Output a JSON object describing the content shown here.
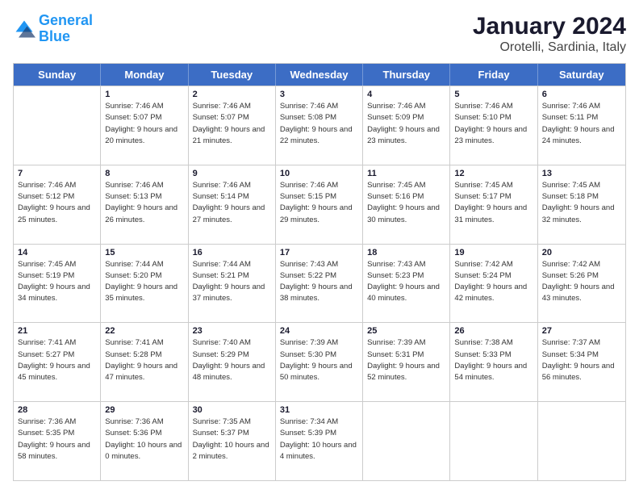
{
  "logo": {
    "line1": "General",
    "line2": "Blue"
  },
  "header": {
    "month": "January 2024",
    "location": "Orotelli, Sardinia, Italy"
  },
  "weekdays": [
    "Sunday",
    "Monday",
    "Tuesday",
    "Wednesday",
    "Thursday",
    "Friday",
    "Saturday"
  ],
  "rows": [
    [
      {
        "day": "",
        "sunrise": "",
        "sunset": "",
        "daylight": ""
      },
      {
        "day": "1",
        "sunrise": "Sunrise: 7:46 AM",
        "sunset": "Sunset: 5:07 PM",
        "daylight": "Daylight: 9 hours and 20 minutes."
      },
      {
        "day": "2",
        "sunrise": "Sunrise: 7:46 AM",
        "sunset": "Sunset: 5:07 PM",
        "daylight": "Daylight: 9 hours and 21 minutes."
      },
      {
        "day": "3",
        "sunrise": "Sunrise: 7:46 AM",
        "sunset": "Sunset: 5:08 PM",
        "daylight": "Daylight: 9 hours and 22 minutes."
      },
      {
        "day": "4",
        "sunrise": "Sunrise: 7:46 AM",
        "sunset": "Sunset: 5:09 PM",
        "daylight": "Daylight: 9 hours and 23 minutes."
      },
      {
        "day": "5",
        "sunrise": "Sunrise: 7:46 AM",
        "sunset": "Sunset: 5:10 PM",
        "daylight": "Daylight: 9 hours and 23 minutes."
      },
      {
        "day": "6",
        "sunrise": "Sunrise: 7:46 AM",
        "sunset": "Sunset: 5:11 PM",
        "daylight": "Daylight: 9 hours and 24 minutes."
      }
    ],
    [
      {
        "day": "7",
        "sunrise": "Sunrise: 7:46 AM",
        "sunset": "Sunset: 5:12 PM",
        "daylight": "Daylight: 9 hours and 25 minutes."
      },
      {
        "day": "8",
        "sunrise": "Sunrise: 7:46 AM",
        "sunset": "Sunset: 5:13 PM",
        "daylight": "Daylight: 9 hours and 26 minutes."
      },
      {
        "day": "9",
        "sunrise": "Sunrise: 7:46 AM",
        "sunset": "Sunset: 5:14 PM",
        "daylight": "Daylight: 9 hours and 27 minutes."
      },
      {
        "day": "10",
        "sunrise": "Sunrise: 7:46 AM",
        "sunset": "Sunset: 5:15 PM",
        "daylight": "Daylight: 9 hours and 29 minutes."
      },
      {
        "day": "11",
        "sunrise": "Sunrise: 7:45 AM",
        "sunset": "Sunset: 5:16 PM",
        "daylight": "Daylight: 9 hours and 30 minutes."
      },
      {
        "day": "12",
        "sunrise": "Sunrise: 7:45 AM",
        "sunset": "Sunset: 5:17 PM",
        "daylight": "Daylight: 9 hours and 31 minutes."
      },
      {
        "day": "13",
        "sunrise": "Sunrise: 7:45 AM",
        "sunset": "Sunset: 5:18 PM",
        "daylight": "Daylight: 9 hours and 32 minutes."
      }
    ],
    [
      {
        "day": "14",
        "sunrise": "Sunrise: 7:45 AM",
        "sunset": "Sunset: 5:19 PM",
        "daylight": "Daylight: 9 hours and 34 minutes."
      },
      {
        "day": "15",
        "sunrise": "Sunrise: 7:44 AM",
        "sunset": "Sunset: 5:20 PM",
        "daylight": "Daylight: 9 hours and 35 minutes."
      },
      {
        "day": "16",
        "sunrise": "Sunrise: 7:44 AM",
        "sunset": "Sunset: 5:21 PM",
        "daylight": "Daylight: 9 hours and 37 minutes."
      },
      {
        "day": "17",
        "sunrise": "Sunrise: 7:43 AM",
        "sunset": "Sunset: 5:22 PM",
        "daylight": "Daylight: 9 hours and 38 minutes."
      },
      {
        "day": "18",
        "sunrise": "Sunrise: 7:43 AM",
        "sunset": "Sunset: 5:23 PM",
        "daylight": "Daylight: 9 hours and 40 minutes."
      },
      {
        "day": "19",
        "sunrise": "Sunrise: 7:42 AM",
        "sunset": "Sunset: 5:24 PM",
        "daylight": "Daylight: 9 hours and 42 minutes."
      },
      {
        "day": "20",
        "sunrise": "Sunrise: 7:42 AM",
        "sunset": "Sunset: 5:26 PM",
        "daylight": "Daylight: 9 hours and 43 minutes."
      }
    ],
    [
      {
        "day": "21",
        "sunrise": "Sunrise: 7:41 AM",
        "sunset": "Sunset: 5:27 PM",
        "daylight": "Daylight: 9 hours and 45 minutes."
      },
      {
        "day": "22",
        "sunrise": "Sunrise: 7:41 AM",
        "sunset": "Sunset: 5:28 PM",
        "daylight": "Daylight: 9 hours and 47 minutes."
      },
      {
        "day": "23",
        "sunrise": "Sunrise: 7:40 AM",
        "sunset": "Sunset: 5:29 PM",
        "daylight": "Daylight: 9 hours and 48 minutes."
      },
      {
        "day": "24",
        "sunrise": "Sunrise: 7:39 AM",
        "sunset": "Sunset: 5:30 PM",
        "daylight": "Daylight: 9 hours and 50 minutes."
      },
      {
        "day": "25",
        "sunrise": "Sunrise: 7:39 AM",
        "sunset": "Sunset: 5:31 PM",
        "daylight": "Daylight: 9 hours and 52 minutes."
      },
      {
        "day": "26",
        "sunrise": "Sunrise: 7:38 AM",
        "sunset": "Sunset: 5:33 PM",
        "daylight": "Daylight: 9 hours and 54 minutes."
      },
      {
        "day": "27",
        "sunrise": "Sunrise: 7:37 AM",
        "sunset": "Sunset: 5:34 PM",
        "daylight": "Daylight: 9 hours and 56 minutes."
      }
    ],
    [
      {
        "day": "28",
        "sunrise": "Sunrise: 7:36 AM",
        "sunset": "Sunset: 5:35 PM",
        "daylight": "Daylight: 9 hours and 58 minutes."
      },
      {
        "day": "29",
        "sunrise": "Sunrise: 7:36 AM",
        "sunset": "Sunset: 5:36 PM",
        "daylight": "Daylight: 10 hours and 0 minutes."
      },
      {
        "day": "30",
        "sunrise": "Sunrise: 7:35 AM",
        "sunset": "Sunset: 5:37 PM",
        "daylight": "Daylight: 10 hours and 2 minutes."
      },
      {
        "day": "31",
        "sunrise": "Sunrise: 7:34 AM",
        "sunset": "Sunset: 5:39 PM",
        "daylight": "Daylight: 10 hours and 4 minutes."
      },
      {
        "day": "",
        "sunrise": "",
        "sunset": "",
        "daylight": ""
      },
      {
        "day": "",
        "sunrise": "",
        "sunset": "",
        "daylight": ""
      },
      {
        "day": "",
        "sunrise": "",
        "sunset": "",
        "daylight": ""
      }
    ]
  ]
}
